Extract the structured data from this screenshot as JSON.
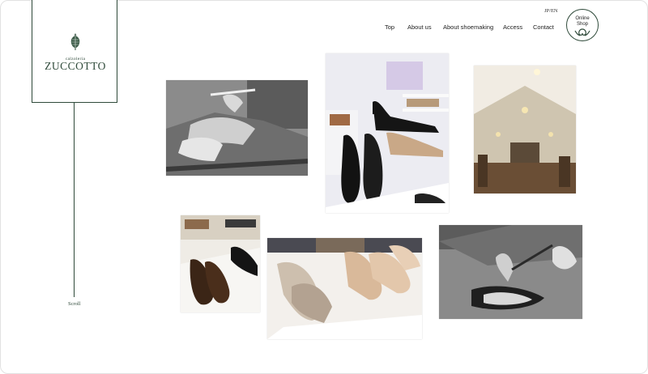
{
  "brand": {
    "small_text": "calzoleria",
    "name": "ZUCCOTTO"
  },
  "lang_switch": "JP/EN",
  "nav": {
    "items": [
      {
        "label": "Top"
      },
      {
        "label": "About us"
      },
      {
        "label": "About shoemaking"
      },
      {
        "label": "Access"
      },
      {
        "label": "Contact"
      }
    ]
  },
  "online_shop": {
    "line1": "Online",
    "line2": "Shop",
    "icon": "ornament-icon"
  },
  "scroll_label": "Scroll",
  "photos": [
    {
      "name": "photo-craft-hands",
      "icon": "image"
    },
    {
      "name": "photo-black-shoes-display",
      "icon": "image"
    },
    {
      "name": "photo-shop-interior",
      "icon": "image"
    },
    {
      "name": "photo-brown-strap-shoes",
      "icon": "image"
    },
    {
      "name": "photo-sandals-display",
      "icon": "image"
    },
    {
      "name": "photo-shoemaking-tools",
      "icon": "image"
    }
  ],
  "colors": {
    "brand_green": "#2f4a3a",
    "background": "#ffffff"
  }
}
